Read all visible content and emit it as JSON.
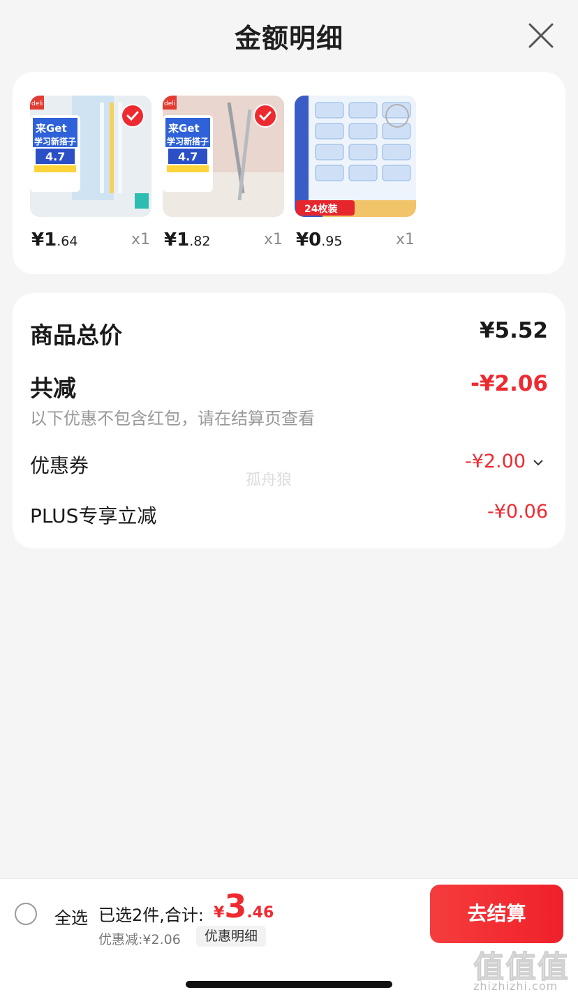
{
  "header": {
    "title": "金额明细"
  },
  "products": [
    {
      "price_int": "¥1",
      "price_dec": ".64",
      "qty": "x1",
      "checked": true,
      "badge": "4.7"
    },
    {
      "price_int": "¥1",
      "price_dec": ".82",
      "qty": "x1",
      "checked": true,
      "badge": "4.7"
    },
    {
      "price_int": "¥0",
      "price_dec": ".95",
      "qty": "x1",
      "checked": false,
      "badge": "24枚装"
    }
  ],
  "summary": {
    "total_label": "商品总价",
    "total_value": "¥5.52",
    "reduce_label": "共减",
    "reduce_value": "-¥2.06",
    "reduce_note": "以下优惠不包含红包，请在结算页查看",
    "coupon_label": "优惠券",
    "coupon_value": "-¥2.00",
    "plus_label": "PLUS专享立减",
    "plus_value": "-¥0.06"
  },
  "watermark": "孤舟狼",
  "bottom": {
    "select_all": "全选",
    "selected_text": "已选2件,合计:",
    "currency": "¥",
    "total_int": "3",
    "total_dec": ".46",
    "discount_text": "优惠减:¥2.06",
    "detail_button": "优惠明细",
    "checkout_button": "去结算"
  },
  "brand_watermark": {
    "text": "值值值",
    "url": "zhizhizhi.com"
  },
  "colors": {
    "accent": "#ee2a31",
    "background": "#f5f5f5",
    "card": "#ffffff"
  }
}
